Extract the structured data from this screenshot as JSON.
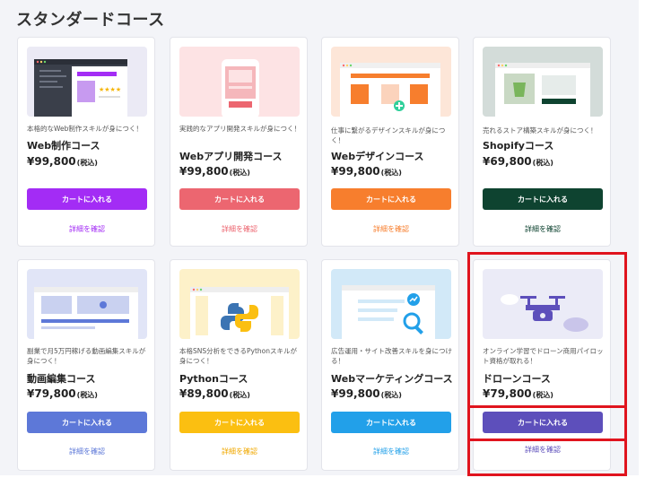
{
  "page_title": "スタンダードコース",
  "courses": [
    {
      "tagline": "本格的なWeb制作スキルが身につく！",
      "name": "Web制作コース",
      "price": "¥99,800",
      "tax": "(税込)",
      "cart_label": "カートに入れる",
      "details_label": "詳細を確認",
      "accent": "#a32cf5",
      "thumb_bg": "#ebeaf5",
      "icon": "web-production-illustration"
    },
    {
      "tagline": "実践的なアプリ開発スキルが身につく！",
      "name": "Webアプリ開発コース",
      "price": "¥99,800",
      "tax": "(税込)",
      "cart_label": "カートに入れる",
      "details_label": "詳細を確認",
      "accent": "#ec6670",
      "thumb_bg": "#fde3e4",
      "icon": "mobile-app-illustration"
    },
    {
      "tagline": "仕事に繋がるデザインスキルが身につく！",
      "name": "Webデザインコース",
      "price": "¥99,800",
      "tax": "(税込)",
      "cart_label": "カートに入れる",
      "details_label": "詳細を確認",
      "accent": "#f77e2d",
      "thumb_bg": "#fde6d8",
      "icon": "web-design-illustration"
    },
    {
      "tagline": "売れるストア構築スキルが身につく！",
      "name": "Shopifyコース",
      "price": "¥69,800",
      "tax": "(税込)",
      "cart_label": "カートに入れる",
      "details_label": "詳細を確認",
      "accent": "#0e4330",
      "thumb_bg": "#d3dcd9",
      "icon": "shopify-store-illustration"
    },
    {
      "tagline": "副業で月5万円稼げる動画編集スキルが身につく！",
      "name": "動画編集コース",
      "price": "¥79,800",
      "tax": "(税込)",
      "cart_label": "カートに入れる",
      "details_label": "詳細を確認",
      "accent": "#5d78d8",
      "thumb_bg": "#e1e5f7",
      "icon": "video-editing-illustration"
    },
    {
      "tagline": "本格SNS分析をできるPythonスキルが身につく！",
      "name": "Pythonコース",
      "price": "¥89,800",
      "tax": "(税込)",
      "cart_label": "カートに入れる",
      "details_label": "詳細を確認",
      "accent": "#fbbf11",
      "thumb_bg": "#fdf1c9",
      "icon": "python-illustration"
    },
    {
      "tagline": "広告運用・サイト改善スキルを身につける！",
      "name": "Webマーケティングコース",
      "price": "¥99,800",
      "tax": "(税込)",
      "cart_label": "カートに入れる",
      "details_label": "詳細を確認",
      "accent": "#22a0e9",
      "thumb_bg": "#d2e9f8",
      "icon": "web-marketing-illustration"
    },
    {
      "tagline": "オンライン学習でドローン商用パイロット資格が取れる！",
      "name": "ドローンコース",
      "price": "¥79,800",
      "tax": "(税込)",
      "cart_label": "カートに入れる",
      "details_label": "詳細を確認",
      "accent": "#5d4fbb",
      "thumb_bg": "#ebebf7",
      "icon": "drone-illustration"
    }
  ]
}
